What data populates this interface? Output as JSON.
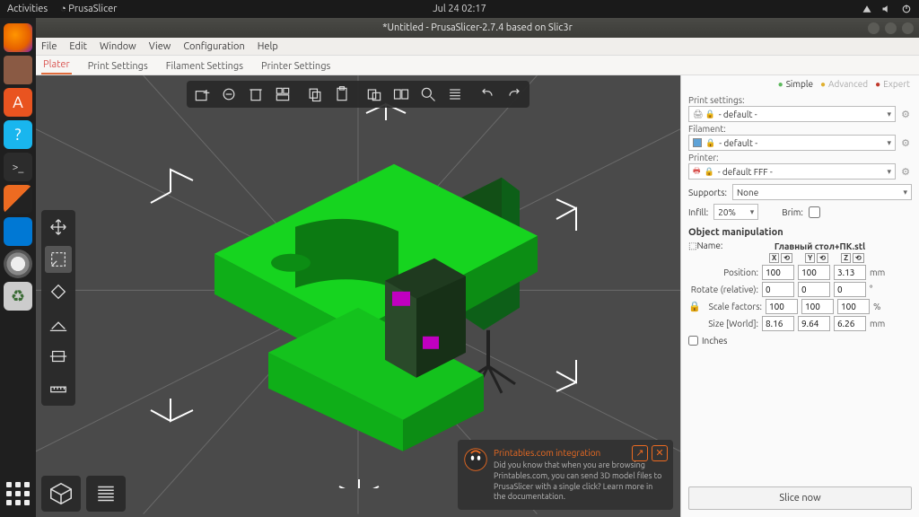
{
  "gnome": {
    "activities": "Activities",
    "app": "PrusaSlicer",
    "clock": "Jul 24  02:17"
  },
  "window": {
    "title": "*Untitled - PrusaSlicer-2.7.4 based on Slic3r"
  },
  "menubar": [
    "File",
    "Edit",
    "Window",
    "View",
    "Configuration",
    "Help"
  ],
  "tabs": [
    "Plater",
    "Print Settings",
    "Filament Settings",
    "Printer Settings"
  ],
  "active_tab": 0,
  "modes": {
    "simple": "Simple",
    "advanced": "Advanced",
    "expert": "Expert"
  },
  "presets": {
    "print_label": "Print settings:",
    "print_value": "- default -",
    "filament_label": "Filament:",
    "filament_value": "- default -",
    "printer_label": "Printer:",
    "printer_value": "- default FFF -"
  },
  "supports": {
    "label": "Supports:",
    "value": "None"
  },
  "infill": {
    "label": "Infill:",
    "value": "20%"
  },
  "brim": {
    "label": "Brim:"
  },
  "object": {
    "section": "Object manipulation",
    "name_label": "Name:",
    "name_value": "Главный стол+ПК.stl",
    "axes": {
      "x": "X",
      "y": "Y",
      "z": "Z"
    },
    "position": {
      "label": "Position:",
      "x": "100",
      "y": "100",
      "z": "3.13",
      "unit": "mm"
    },
    "rotate": {
      "label": "Rotate (relative):",
      "x": "0",
      "y": "0",
      "z": "0",
      "unit": "°"
    },
    "scale": {
      "label": "Scale factors:",
      "x": "100",
      "y": "100",
      "z": "100",
      "unit": "%"
    },
    "size": {
      "label": "Size [World]:",
      "x": "8.16",
      "y": "9.64",
      "z": "6.26",
      "unit": "mm"
    },
    "inches": "Inches"
  },
  "slice_btn": "Slice now",
  "toast": {
    "title": "Printables.com integration",
    "body": "Did you know that when you are browsing Printables.com, you can send 3D model files to PrusaSlicer with a single click? Learn more in the documentation."
  }
}
